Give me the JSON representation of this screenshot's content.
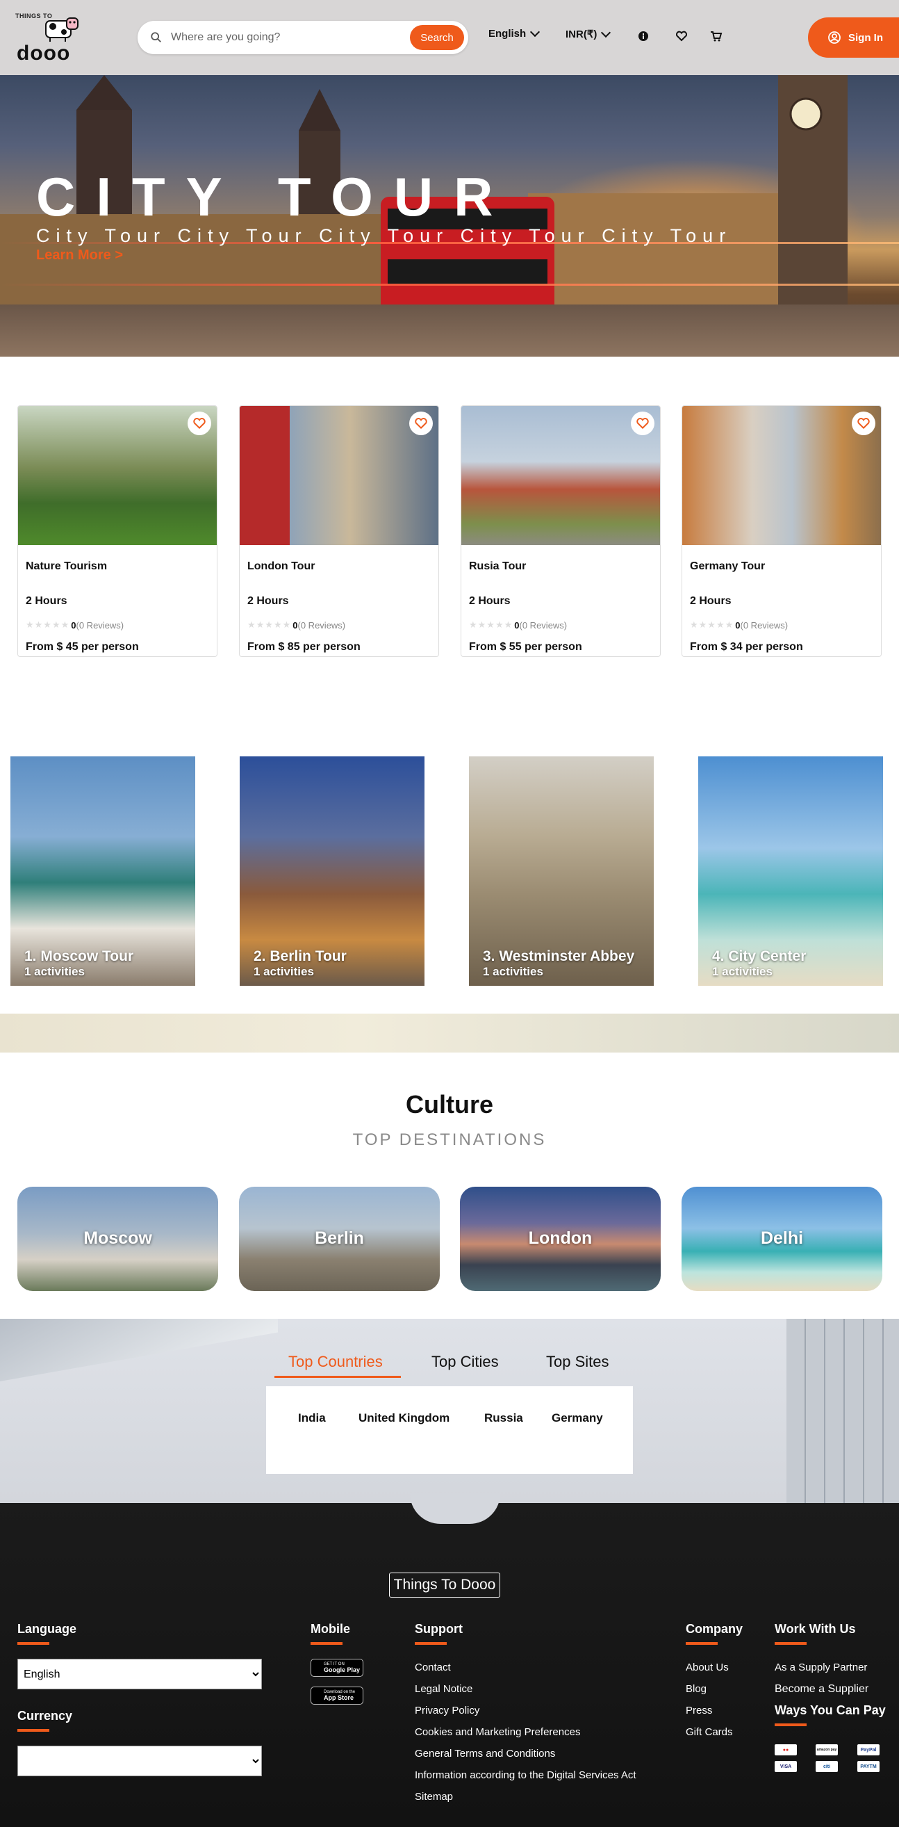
{
  "header": {
    "logo_small": "THINGS TO",
    "logo_big": "dooo",
    "search_placeholder": "Where are you going?",
    "search_button": "Search",
    "language": "English",
    "currency": "INR(₹)",
    "sign_in": "Sign In",
    "accent": "#ef5a1b"
  },
  "hero": {
    "title": "CITY TOUR",
    "subtitle": "City Tour City Tour City Tour City Tour City Tour",
    "cta": "Learn More >"
  },
  "tours": [
    {
      "name": "Nature Tourism",
      "duration": "2 Hours",
      "rating": "0",
      "reviews": "(0 Reviews)",
      "price": "From $ 45 per person"
    },
    {
      "name": "London Tour",
      "duration": "2 Hours",
      "rating": "0",
      "reviews": "(0 Reviews)",
      "price": "From $ 85 per person"
    },
    {
      "name": "Rusia Tour",
      "duration": "2 Hours",
      "rating": "0",
      "reviews": "(0 Reviews)",
      "price": "From $ 55 per person"
    },
    {
      "name": "Germany Tour",
      "duration": "2 Hours",
      "rating": "0",
      "reviews": "(0 Reviews)",
      "price": "From $ 34 per person"
    }
  ],
  "destinations": [
    {
      "name": "1. Moscow Tour",
      "count": "1 activities"
    },
    {
      "name": "2. Berlin Tour",
      "count": "1 activities"
    },
    {
      "name": "3. Westminster Abbey",
      "count": "1 activities"
    },
    {
      "name": "4. City Center",
      "count": "1 activities"
    }
  ],
  "culture": {
    "title": "Culture",
    "subtitle": "TOP DESTINATIONS",
    "cities": [
      "Moscow",
      "Berlin",
      "London",
      "Delhi"
    ]
  },
  "top": {
    "tabs": [
      "Top Countries",
      "Top Cities",
      "Top Sites"
    ],
    "countries": [
      "India",
      "United Kingdom",
      "Russia",
      "Germany"
    ]
  },
  "footer": {
    "logo": "Things To Dooo",
    "language_heading": "Language",
    "language_value": "English",
    "currency_heading": "Currency",
    "mobile_heading": "Mobile",
    "google_play_small": "GET IT ON",
    "google_play": "Google Play",
    "app_store_small": "Download on the",
    "app_store": "App Store",
    "support_heading": "Support",
    "support_links": [
      "Contact",
      "Legal Notice",
      "Privacy Policy",
      "Cookies and Marketing Preferences",
      "General Terms and Conditions",
      "Information according to the Digital Services Act",
      "Sitemap"
    ],
    "company_heading": "Company",
    "company_links": [
      "About Us",
      "Blog",
      "Press",
      "Gift Cards"
    ],
    "work_heading": "Work With Us",
    "work_links": [
      "As a Supply Partner",
      "Become a Supplier"
    ],
    "pay_heading": "Ways You Can Pay",
    "pay_methods": [
      "mastercard",
      "amazon pay",
      "PayPal",
      "VISA",
      "citi",
      "PAYTM"
    ]
  }
}
